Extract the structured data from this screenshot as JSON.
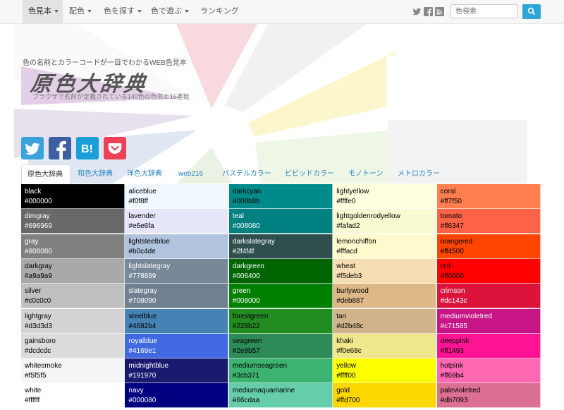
{
  "navbar": {
    "items": [
      {
        "label": "色見本",
        "dropdown": true,
        "active": true
      },
      {
        "label": "配色",
        "dropdown": true,
        "active": false
      },
      {
        "label": "色を探す",
        "dropdown": true,
        "active": false
      },
      {
        "label": "色で遊ぶ",
        "dropdown": true,
        "active": false
      },
      {
        "label": "ランキング",
        "dropdown": false,
        "active": false
      }
    ],
    "social_icons": [
      "twitter-icon",
      "facebook-icon",
      "rss-icon"
    ],
    "search": {
      "placeholder": "色検索",
      "button_icon": "search-icon"
    }
  },
  "header": {
    "tagline": "色の名前とカラーコードが一目でわかるWEB色見本",
    "logo": "原色大辞典",
    "subtitle": "ブラウザで名前が定義されている140色の色名と16進数",
    "share_buttons": [
      {
        "icon": "twitter-icon",
        "color": "#3aa3db"
      },
      {
        "icon": "facebook-icon",
        "color": "#3f5fa3"
      },
      {
        "icon": "hatena-bookmark-icon",
        "color": "#1a9fd9"
      },
      {
        "icon": "pocket-icon",
        "color": "#ee4056"
      }
    ]
  },
  "tabs": [
    {
      "label": "原色大辞典",
      "active": true
    },
    {
      "label": "和色大辞典",
      "active": false
    },
    {
      "label": "洋色大辞典",
      "active": false
    },
    {
      "label": "web216",
      "active": false
    },
    {
      "label": "パステルカラー",
      "active": false
    },
    {
      "label": "ビビッドカラー",
      "active": false
    },
    {
      "label": "モノトーン",
      "active": false
    },
    {
      "label": "メトロカラー",
      "active": false
    }
  ],
  "colors": [
    [
      {
        "name": "black",
        "hex": "#000000",
        "text": "#ffffff"
      },
      {
        "name": "dimgray",
        "hex": "#696969",
        "text": "#ffffff"
      },
      {
        "name": "gray",
        "hex": "#808080",
        "text": "#ffffff"
      },
      {
        "name": "darkgray",
        "hex": "#a9a9a9",
        "text": "#000000"
      },
      {
        "name": "silver",
        "hex": "#c0c0c0",
        "text": "#000000"
      },
      {
        "name": "lightgray",
        "hex": "#d3d3d3",
        "text": "#000000"
      },
      {
        "name": "gainsboro",
        "hex": "#dcdcdc",
        "text": "#000000"
      },
      {
        "name": "whitesmoke",
        "hex": "#f5f5f5",
        "text": "#000000"
      },
      {
        "name": "white",
        "hex": "#ffffff",
        "text": "#000000"
      }
    ],
    [
      {
        "name": "aliceblue",
        "hex": "#f0f8ff",
        "text": "#000000"
      },
      {
        "name": "lavender",
        "hex": "#e6e6fa",
        "text": "#000000"
      },
      {
        "name": "lightsteelblue",
        "hex": "#b0c4de",
        "text": "#000000"
      },
      {
        "name": "lightslategray",
        "hex": "#778899",
        "text": "#ffffff"
      },
      {
        "name": "slategray",
        "hex": "#708090",
        "text": "#ffffff"
      },
      {
        "name": "steelblue",
        "hex": "#4682b4",
        "text": "#000000"
      },
      {
        "name": "royalblue",
        "hex": "#4169e1",
        "text": "#ffffff"
      },
      {
        "name": "midnightblue",
        "hex": "#191970",
        "text": "#ffffff"
      },
      {
        "name": "navy",
        "hex": "#000080",
        "text": "#ffffff"
      }
    ],
    [
      {
        "name": "darkcyan",
        "hex": "#008b8b",
        "text": "#000000"
      },
      {
        "name": "teal",
        "hex": "#008080",
        "text": "#ffffff"
      },
      {
        "name": "darkslategray",
        "hex": "#2f4f4f",
        "text": "#ffffff"
      },
      {
        "name": "darkgreen",
        "hex": "#006400",
        "text": "#ffffff"
      },
      {
        "name": "green",
        "hex": "#008000",
        "text": "#ffffff"
      },
      {
        "name": "forestgreen",
        "hex": "#228b22",
        "text": "#000000"
      },
      {
        "name": "seagreen",
        "hex": "#2e8b57",
        "text": "#000000"
      },
      {
        "name": "mediumseagreen",
        "hex": "#3cb371",
        "text": "#000000"
      },
      {
        "name": "mediumaquamarine",
        "hex": "#66cdaa",
        "text": "#000000"
      }
    ],
    [
      {
        "name": "lightyellow",
        "hex": "#ffffe0",
        "text": "#000000"
      },
      {
        "name": "lightgoldenrodyellow",
        "hex": "#fafad2",
        "text": "#000000"
      },
      {
        "name": "lemonchiffon",
        "hex": "#fffacd",
        "text": "#000000"
      },
      {
        "name": "wheat",
        "hex": "#f5deb3",
        "text": "#000000"
      },
      {
        "name": "burlywood",
        "hex": "#deb887",
        "text": "#000000"
      },
      {
        "name": "tan",
        "hex": "#d2b48c",
        "text": "#000000"
      },
      {
        "name": "khaki",
        "hex": "#f0e68c",
        "text": "#000000"
      },
      {
        "name": "yellow",
        "hex": "#ffff00",
        "text": "#000000"
      },
      {
        "name": "gold",
        "hex": "#ffd700",
        "text": "#000000"
      }
    ],
    [
      {
        "name": "coral",
        "hex": "#ff7f50",
        "text": "#000000"
      },
      {
        "name": "tomato",
        "hex": "#ff6347",
        "text": "#000000"
      },
      {
        "name": "orangered",
        "hex": "#ff4500",
        "text": "#000000"
      },
      {
        "name": "red",
        "hex": "#ff0000",
        "text": "#000000"
      },
      {
        "name": "crimson",
        "hex": "#dc143c",
        "text": "#ffffff"
      },
      {
        "name": "mediumvioletred",
        "hex": "#c71585",
        "text": "#ffffff"
      },
      {
        "name": "deeppink",
        "hex": "#ff1493",
        "text": "#000000"
      },
      {
        "name": "hotpink",
        "hex": "#ff69b4",
        "text": "#000000"
      },
      {
        "name": "palevioletred",
        "hex": "#db7093",
        "text": "#000000"
      }
    ]
  ]
}
